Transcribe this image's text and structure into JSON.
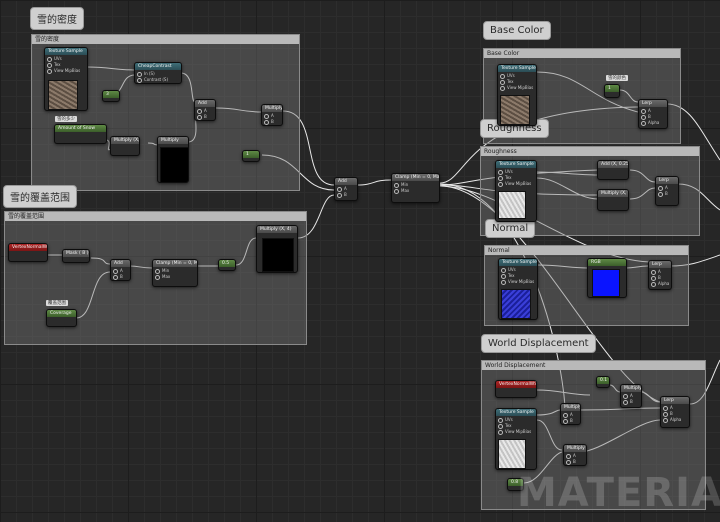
{
  "bubbles": {
    "snow_density": "雪的密度",
    "snow_coverage": "雪的覆盖范围",
    "base_color": "Base Color",
    "roughness": "Roughness",
    "normal": "Normal",
    "world_displacement": "World Displacement"
  },
  "comments": {
    "snow_density": "雪的密度",
    "snow_coverage": "雪的覆盖范围",
    "base_color": "Base Color",
    "roughness": "Roughness",
    "normal": "Normal",
    "world_displacement": "World Displacement"
  },
  "nodes": {
    "tex_sample": "Texture Sample",
    "cheap_contrast": "CheapContrast",
    "cheap_contrast_pins": [
      "In (S)",
      "Contrast (S)"
    ],
    "cheap_contrast_out": "Result",
    "amount_of_snow": "Amount of Snow",
    "amount_tag": "雪的多少",
    "add": "Add",
    "multiply": "Multiply",
    "multiply_0": "Multiply (X, 0)",
    "multiply_4": "Multiply (X, 4)",
    "clamp": "Clamp (Min = 0, Max = 1)",
    "clamp_pins": [
      "Min",
      "Max"
    ],
    "vertex_normal": "VertexNormalWS",
    "mask_b": "Mask ( B )",
    "coverage": "Coverage",
    "coverage_tag": "覆盖范围",
    "lerp": "Lerp",
    "lerp_pins": [
      "A",
      "B",
      "Alpha"
    ],
    "tex_pins": [
      "UVs",
      "Tex",
      "View MipBias"
    ],
    "ab_pins": [
      "A",
      "B"
    ],
    "rg_label": "RGB",
    "add_025": "Add (X, 0.25)",
    "multiply_05": "Multiply (X, 0.5)",
    "snow_color_tag": "雪的颜色",
    "const_3": "3",
    "const_0": "0",
    "const_1": "1",
    "const_05": "0.5",
    "const_08": "0.8",
    "const_01": "0.1"
  },
  "watermark": "MATERIAL",
  "colors": {
    "wire": "#e6e6e6",
    "header_green": "#4d7a35",
    "header_red": "#a01d1d",
    "comment_bg": "#6b6b6b"
  }
}
